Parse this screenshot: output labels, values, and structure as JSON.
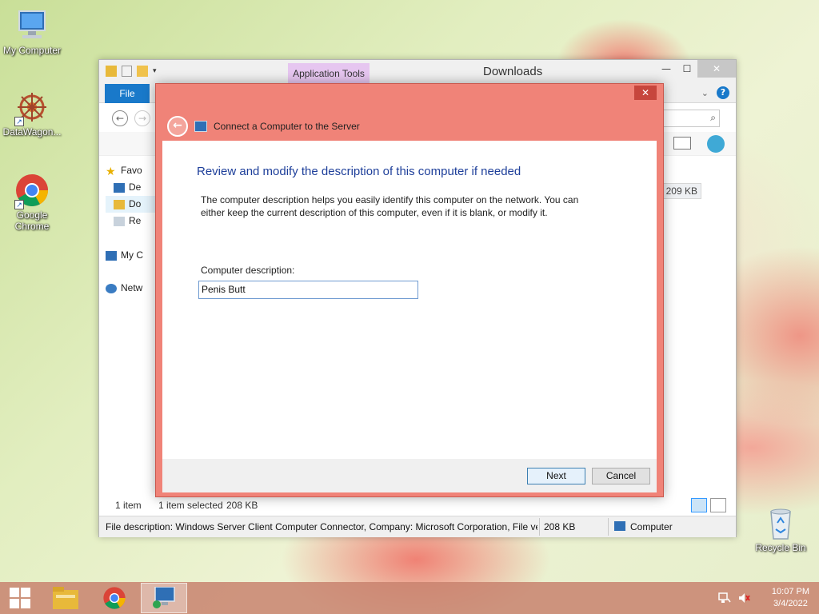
{
  "desktop": {
    "icons": [
      {
        "label": "My Computer"
      },
      {
        "label": "DataWagon..."
      },
      {
        "label": "Google Chrome"
      },
      {
        "label": "Recycle Bin"
      }
    ]
  },
  "explorer": {
    "context_tab": "Application Tools",
    "title": "Downloads",
    "file_tab": "File",
    "nav_items": [
      "Favo",
      "De",
      "Do",
      "Re",
      "My C",
      "Netw"
    ],
    "size_value": "209 KB",
    "status": {
      "item_count": "1 item",
      "selected": "1 item selected",
      "selected_size": "208 KB"
    },
    "details_bar": {
      "description": "File description: Windows Server Client Computer Connector, Company: Microsoft Corporation, File ve",
      "size": "208 KB",
      "location": "Computer"
    }
  },
  "dialog": {
    "title": "Connect a Computer to the Server",
    "heading": "Review and modify the description of this computer if needed",
    "description": "The computer description helps you easily identify this computer on the network. You can either keep the current description of this computer, even if it is blank, or modify it.",
    "field_label": "Computer description:",
    "field_value": "Penis Butt",
    "next_label": "Next",
    "cancel_label": "Cancel",
    "close_glyph": "✕"
  },
  "taskbar": {
    "time": "10:07 PM",
    "date": "3/4/2022"
  },
  "colors": {
    "accent": "#1979ca",
    "dialog_frame": "#f08378",
    "heading": "#1e3f9a"
  }
}
